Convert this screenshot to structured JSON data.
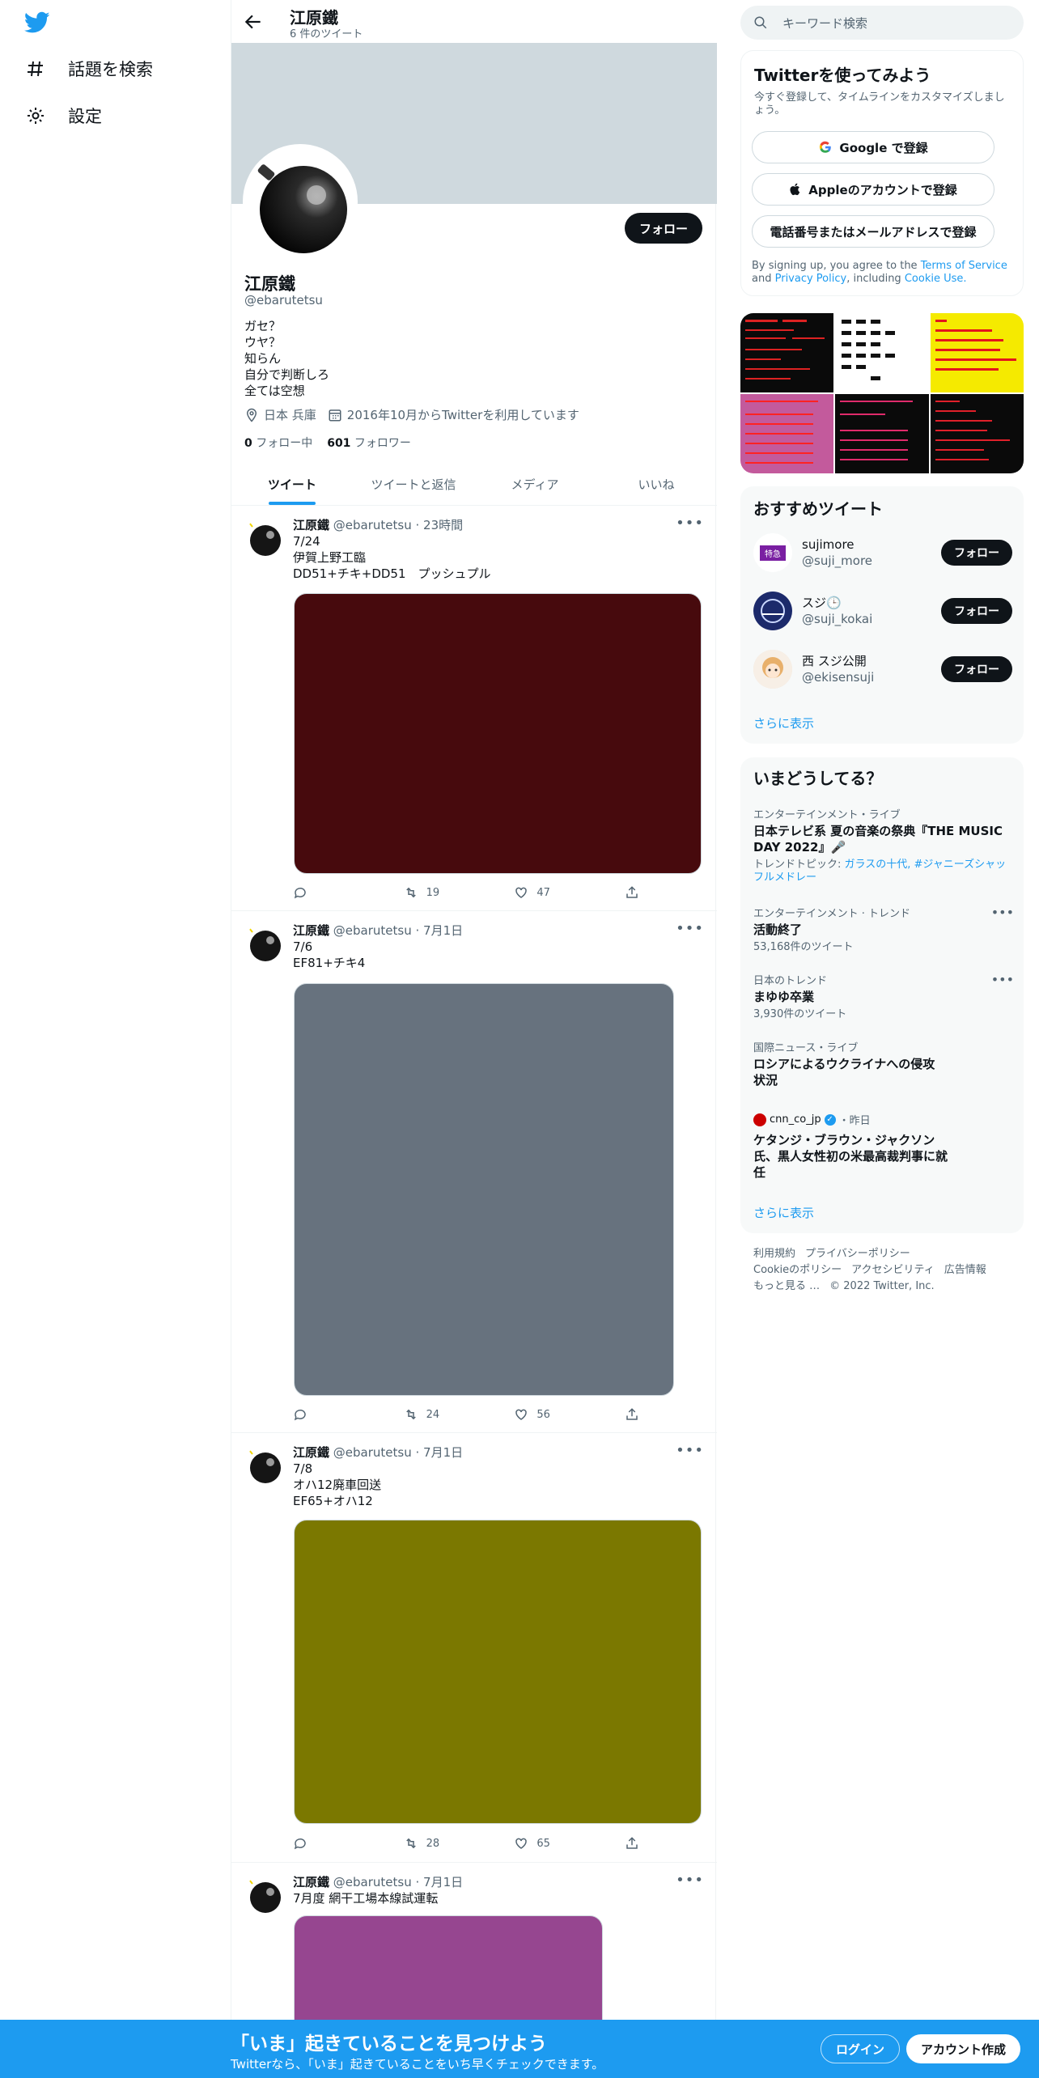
{
  "nav": {
    "explore": "話題を検索",
    "settings": "設定"
  },
  "profile": {
    "top_name": "江原鐵",
    "tweet_count": "6 件のツイート",
    "name": "江原鐵",
    "handle": "@ebarutetsu",
    "follow": "フォロー",
    "bio": [
      "ガセ？",
      "ウヤ？",
      "知らん",
      "自分で判断しろ",
      "全ては空想"
    ],
    "location": "日本 兵庫",
    "joined": "2016年10月からTwitterを利用しています",
    "following_count": "0",
    "following_label": "フォロー中",
    "followers_count": "601",
    "followers_label": "フォロワー"
  },
  "tabs": [
    "ツイート",
    "ツイートと返信",
    "メディア",
    "いいね"
  ],
  "tweets": [
    {
      "name": "江原鐵",
      "handle": "@ebarutetsu",
      "time": "23時間",
      "text": "7/24\n伊賀上野工臨\nDD51+チキ+DD51　プッシュプル",
      "media_color": "#470a0d",
      "retweets": "19",
      "likes": "47"
    },
    {
      "name": "江原鐵",
      "handle": "@ebarutetsu",
      "time": "7月1日",
      "text": "7/6\nEF81+チキ4",
      "media_color": "#67727e",
      "retweets": "24",
      "likes": "56"
    },
    {
      "name": "江原鐵",
      "handle": "@ebarutetsu",
      "time": "7月1日",
      "text": "7/8\nオハ12廃車回送\nEF65+オハ12",
      "media_color": "#7b7800",
      "retweets": "28",
      "likes": "65"
    },
    {
      "name": "江原鐵",
      "handle": "@ebarutetsu",
      "time": "7月1日",
      "text": "7月度 網干工場本線試運転",
      "media_color": "#964690",
      "retweets": "",
      "likes": ""
    }
  ],
  "right": {
    "search_placeholder": "キーワード検索",
    "signup_title": "Twitterを使ってみよう",
    "signup_desc": "今すぐ登録して、タイムラインをカスタマイズしましょう。",
    "google_btn": "Google で登録",
    "apple_btn": "Appleのアカウントで登録",
    "phone_btn": "電話番号またはメールアドレスで登録",
    "terms_pre": "By signing up, you agree to the",
    "terms": "Terms of Service",
    "and": "and",
    "privacy": "Privacy Policy",
    "including": ", including",
    "cookie": "Cookie Use.",
    "rec_title": "おすすめツイート",
    "recs": [
      {
        "name": "sujimore",
        "handle": "@suji_more",
        "follow": "フォロー",
        "badge": "特急"
      },
      {
        "name": "スジ🕒",
        "handle": "@suji_kokai",
        "follow": "フォロー"
      },
      {
        "name": "西 スジ公開",
        "handle": "@ekisensuji",
        "follow": "フォロー"
      }
    ],
    "show_more": "さらに表示",
    "trends_title": "いまどうしてる？",
    "trends": [
      {
        "cat": "エンターテインメント・ライブ",
        "title": "日本テレビ系 夏の音楽の祭典『THE MUSIC DAY 2022』🎤",
        "sub_pre": "トレンドトピック: ",
        "sub_link": "ガラスの十代, #ジャニーズシャッフルメドレー"
      },
      {
        "cat": "エンターテインメント · トレンド",
        "title": "活動終了",
        "sub": "53,168件のツイート"
      },
      {
        "cat": "日本のトレンド",
        "title": "まゆゆ卒業",
        "sub": "3,930件のツイート"
      },
      {
        "cat": "国際ニュース・ライブ",
        "title": "ロシアによるウクライナへの侵攻状況"
      },
      {
        "source": "cnn_co_jp",
        "when": "・昨日",
        "title": "ケタンジ・ブラウン・ジャクソン氏、黒人女性初の米最高裁判事に就任"
      }
    ],
    "show_more2": "さらに表示",
    "footer": [
      "利用規約",
      "プライバシーポリシー",
      "Cookieのポリシー",
      "アクセシビリティ",
      "広告情報",
      "もっと見る …",
      "© 2022 Twitter, Inc."
    ]
  },
  "bottom": {
    "title": "「いま」起きていることを見つけよう",
    "sub": "Twitterなら、「いま」起きていることをいち早くチェックできます。",
    "login": "ログイン",
    "signup": "アカウント作成"
  },
  "colors": {
    "accent": "#1d9bf0",
    "dark": "#0f1419",
    "muted": "#536471"
  }
}
